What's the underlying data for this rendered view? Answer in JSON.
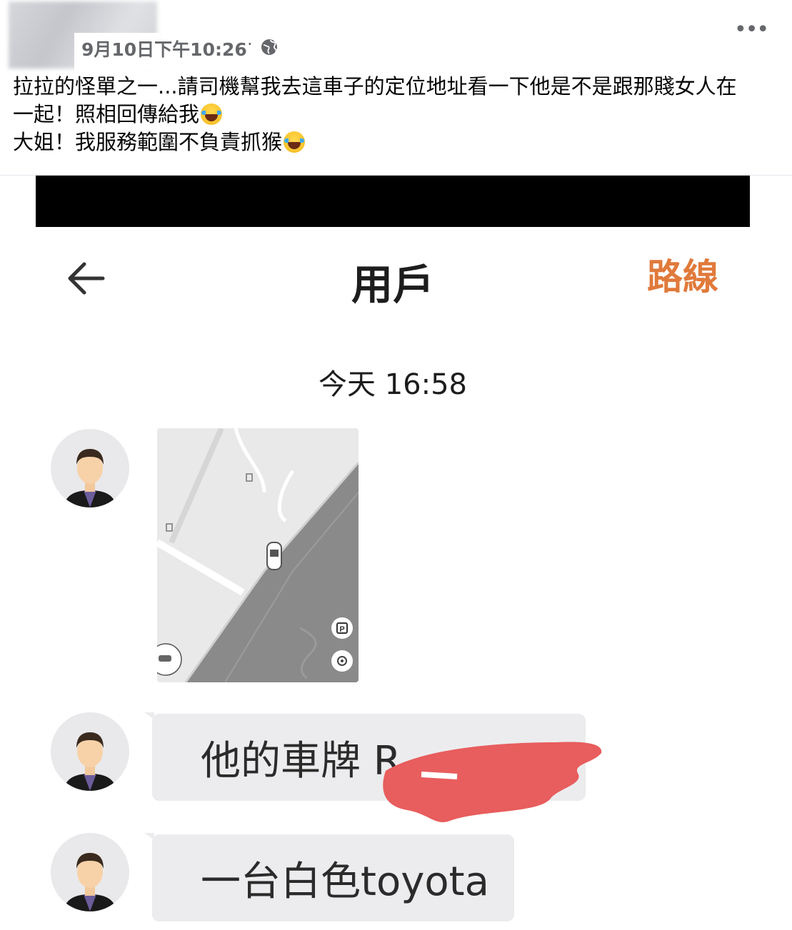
{
  "post": {
    "timestamp": "9月10日下午10:26",
    "separator": "·",
    "text_line1": "拉拉的怪單之一...請司機幫我去這車子的定位地址看一下他是不是跟那賤女人在",
    "text_line2": "一起！照相回傳給我",
    "text_line3": "大姐！我服務範圍不負責抓猴",
    "more_label": "•••"
  },
  "chat": {
    "title": "用戶",
    "route_label": "路線",
    "timestamp": "今天 16:58",
    "messages": [
      {
        "type": "location",
        "map_labels": [
          "P"
        ]
      },
      {
        "type": "text",
        "text": "他的車牌 R"
      },
      {
        "type": "text",
        "text": "一台白色toyota"
      }
    ]
  },
  "colors": {
    "accent": "#e07a3b",
    "bubble": "#ececee",
    "redaction": "#e85d5d",
    "post_meta": "#65676b"
  },
  "icons": [
    "globe-icon",
    "more-icon",
    "back-arrow-icon",
    "user-avatar-icon",
    "parking-icon",
    "locate-icon",
    "car-icon",
    "laughing-crying-emoji"
  ]
}
